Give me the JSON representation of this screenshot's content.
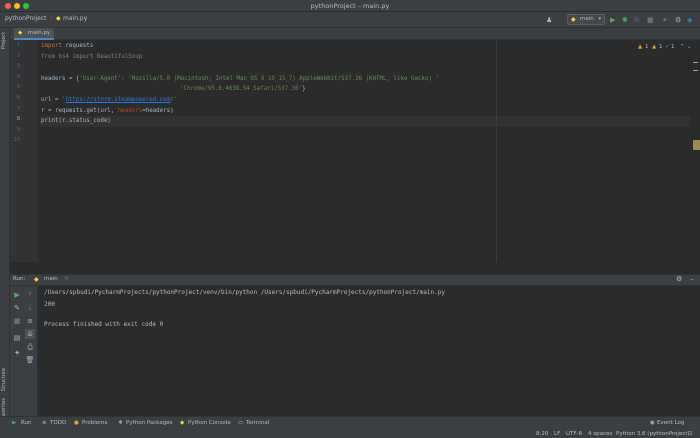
{
  "window": {
    "title": "pythonProject – main.py"
  },
  "navbar": {
    "project": "pythonProject",
    "file": "main.py",
    "run_config": "main"
  },
  "left_strip": {
    "project_tab": "Project",
    "structure_tab": "Structure",
    "favorites_tab": "Favorites"
  },
  "editor": {
    "tab": "main.py",
    "line_numbers": [
      "1",
      "2",
      "3",
      "4",
      "5",
      "6",
      "7",
      "8",
      "9",
      "10"
    ],
    "inspections": {
      "warnings_a": "1",
      "warnings_b": "1",
      "weak": "1"
    },
    "lines": {
      "l1_kw": "import",
      "l1_rest": " requests",
      "l2": "from bs4 import BeautifulSoup",
      "l4_a": "headers = {",
      "l4_s1": "'User-Agent'",
      "l4_b": ": ",
      "l4_s2": "'Mozilla/5.0 (Macintosh; Intel Mac OS X 10_15_7) AppleWebKit/537.36 (KHTML, like Gecko) '",
      "l5_s": "'Chrome/95.0.4638.54 Safari/537.36'",
      "l5_end": "}",
      "l6_a": "url = ",
      "l6_q1": "'",
      "l6_link": "https://store.steampowered.com",
      "l6_q2": "/'",
      "l7_a": "r = requests.get(url, ",
      "l7_p": "headers",
      "l7_b": "=headers)",
      "l8": "print(r.status_code)"
    }
  },
  "run_panel": {
    "label": "Run:",
    "tab": "main",
    "command": "/Users/spbudi/PycharmProjects/pythonProject/venv/bin/python /Users/spbudi/PycharmProjects/pythonProject/main.py",
    "output": "200",
    "exit": "Process finished with exit code 0"
  },
  "bottom_tabs": {
    "run": "Run",
    "todo": "TODO",
    "problems": "Problems",
    "packages": "Python Packages",
    "console": "Python Console",
    "terminal": "Terminal",
    "event_log": "Event Log"
  },
  "status": {
    "position": "8:20",
    "line_sep": "LF",
    "encoding": "UTF-8",
    "indent": "4 spaces",
    "interpreter": "Python 3.8 (pythonProject)"
  }
}
